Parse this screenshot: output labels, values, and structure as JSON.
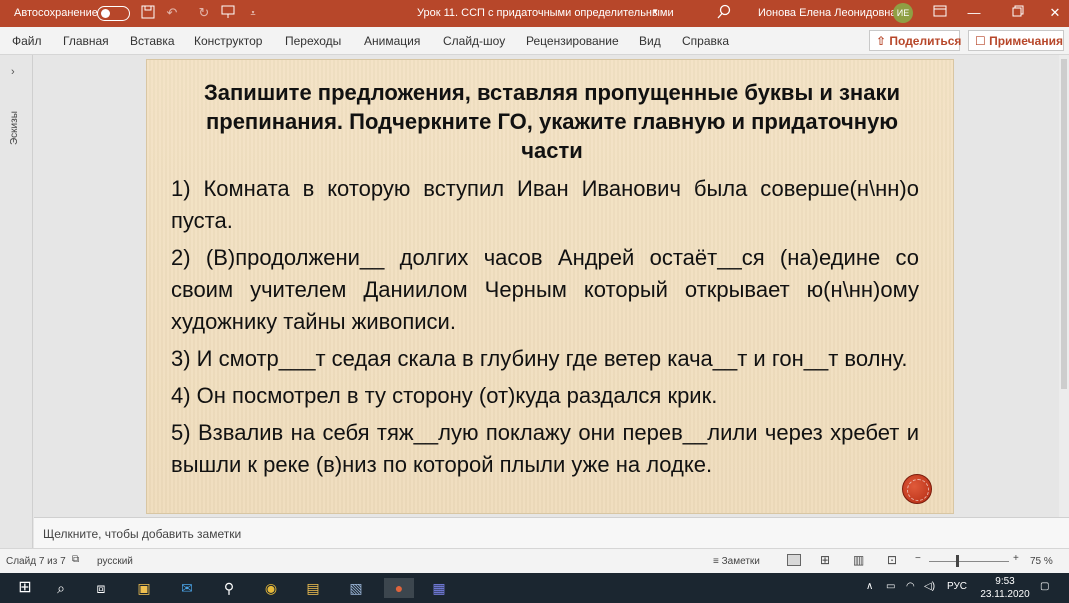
{
  "titlebar": {
    "autosave_label": "Автосохранение",
    "document_title": "Урок 11. ССП с придаточными определительными",
    "user_name": "Ионова Елена Леонидовна",
    "user_initials": "ИЕ"
  },
  "ribbon": {
    "tabs": [
      "Файл",
      "Главная",
      "Вставка",
      "Конструктор",
      "Переходы",
      "Анимация",
      "Слайд-шоу",
      "Рецензирование",
      "Вид",
      "Справка"
    ],
    "share_label": "Поделиться",
    "comments_label": "Примечания"
  },
  "thumbnails": {
    "label": "Эскизы"
  },
  "slide": {
    "title": "Запишите предложения, вставляя пропущенные буквы и знаки препинания. Подчеркните ГО, укажите главную и придаточную части",
    "items": [
      "1) Комната в которую вступил Иван Иванович была соверше(н\\нн)о пуста.",
      "2) (В)продолжени__ долгих часов Андрей остаёт__ся (на)едине со своим учителем Даниилом Черным который открывает ю(н\\нн)ому художнику тайны живописи.",
      "3) И смотр___т седая скала в глубину где ветер кача__т и гон__т волну.",
      "4) Он посмотрел в ту сторону (от)куда раздался крик.",
      "5) Взвалив на себя тяж__лую поклажу они перев__лили через хребет и вышли к реке (в)низ по которой плыли уже на лодке."
    ]
  },
  "notes": {
    "placeholder": "Щелкните, чтобы добавить заметки"
  },
  "statusbar": {
    "slide_counter": "Слайд 7 из 7",
    "language": "русский",
    "notes_label": "Заметки",
    "zoom": "75 %"
  },
  "taskbar": {
    "language": "РУС",
    "time": "9:53",
    "date": "23.11.2020"
  }
}
